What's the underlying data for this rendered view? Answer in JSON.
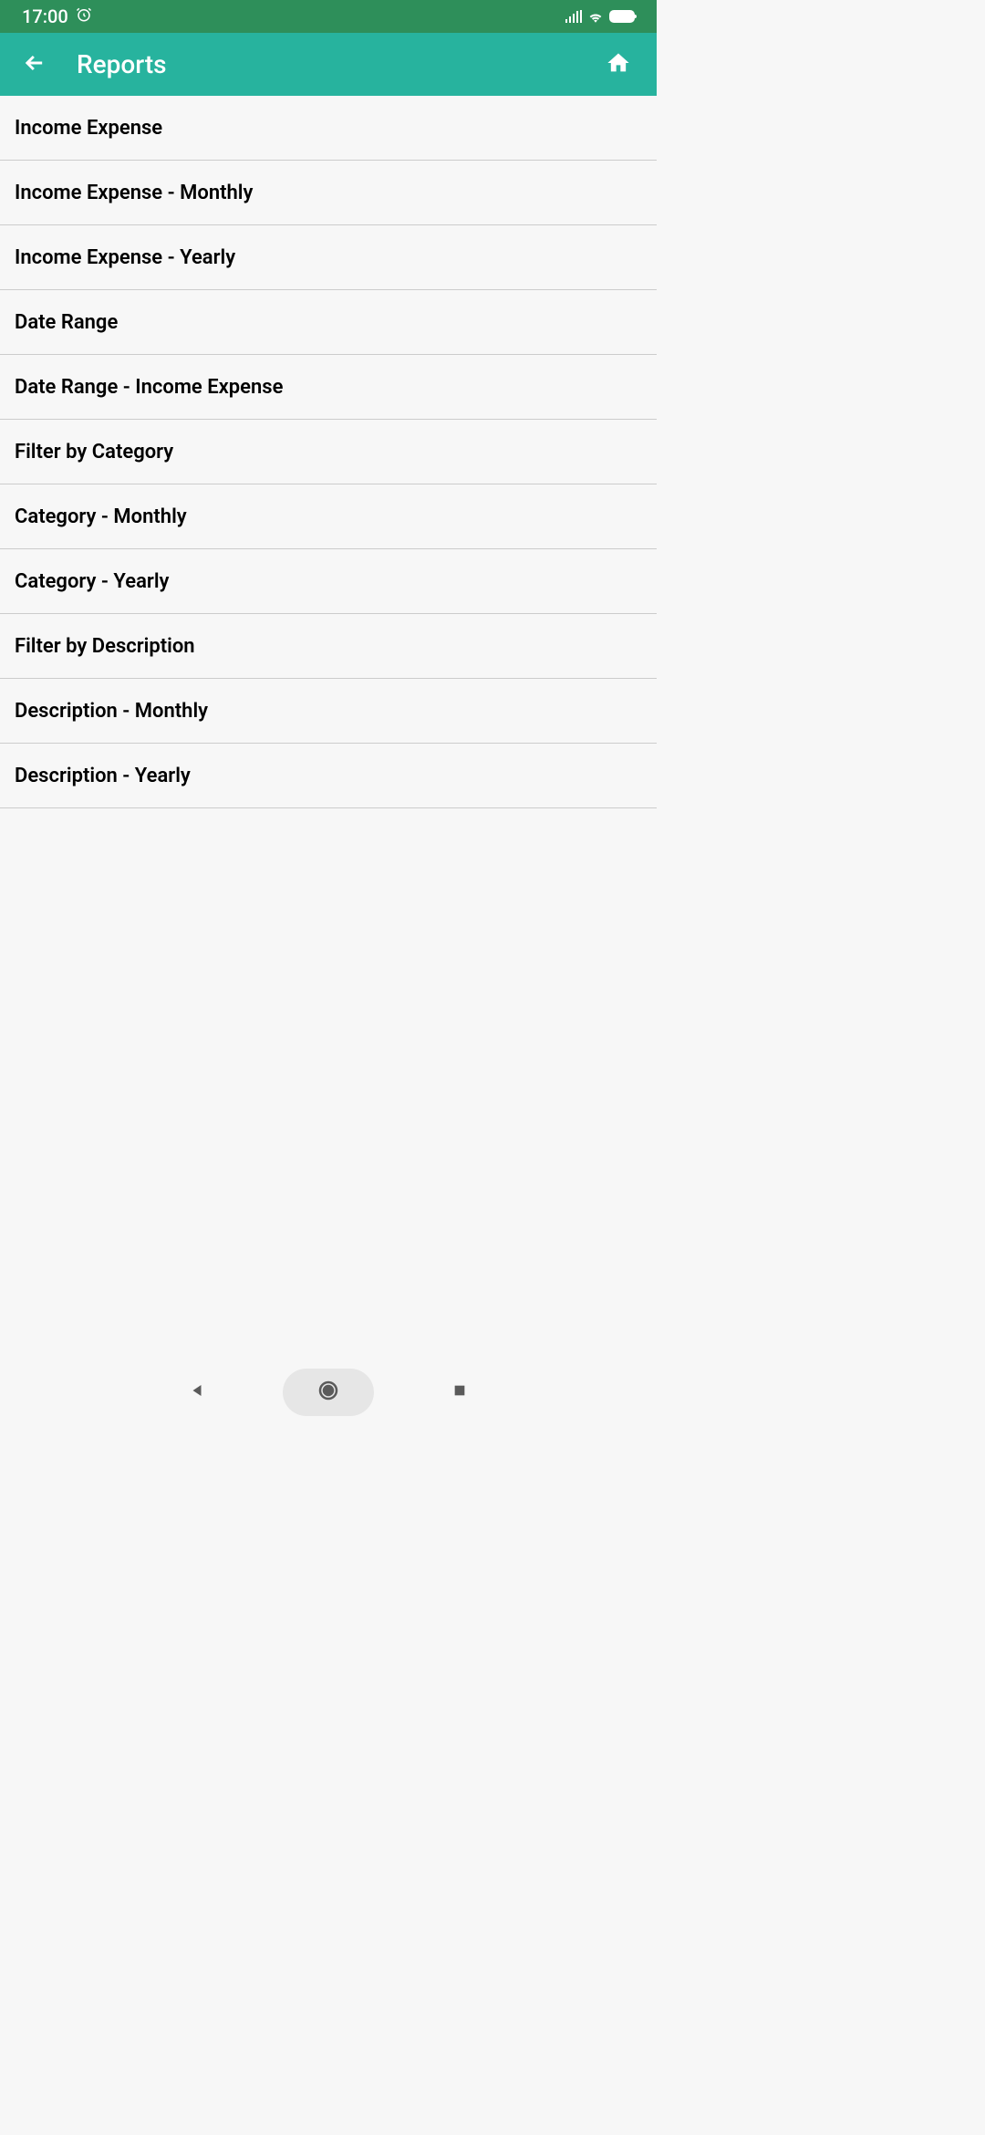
{
  "status": {
    "time": "17:00"
  },
  "header": {
    "title": "Reports"
  },
  "reports": [
    {
      "label": "Income Expense"
    },
    {
      "label": "Income Expense - Monthly"
    },
    {
      "label": "Income Expense - Yearly"
    },
    {
      "label": "Date Range"
    },
    {
      "label": "Date Range - Income Expense"
    },
    {
      "label": "Filter by Category"
    },
    {
      "label": "Category - Monthly"
    },
    {
      "label": "Category - Yearly"
    },
    {
      "label": "Filter by Description"
    },
    {
      "label": "Description - Monthly"
    },
    {
      "label": "Description - Yearly"
    }
  ]
}
